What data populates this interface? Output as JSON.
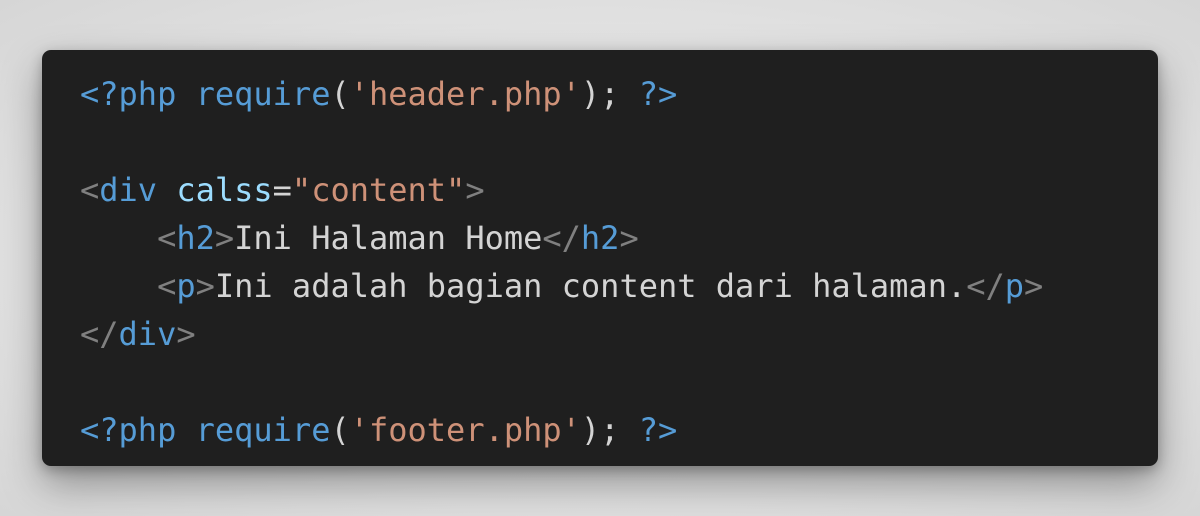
{
  "colors": {
    "background": "#e6e6e6",
    "editor_bg": "#1f1f1f",
    "keyword": "#569cd6",
    "string": "#ce9178",
    "bracket": "#808080",
    "attribute": "#9cdcfe",
    "text": "#d4d4d4"
  },
  "code": {
    "line1": {
      "open": "<?php",
      "fn": "require",
      "lparen": "(",
      "arg": "'header.php'",
      "rparen_semi": ");",
      "close": "?>"
    },
    "line3": {
      "lt": "<",
      "tag": "div",
      "attr": "calss",
      "eq": "=",
      "value": "\"content\"",
      "gt": ">"
    },
    "line4": {
      "indent": "    ",
      "lt1": "<",
      "tag1": "h2",
      "gt1": ">",
      "text": "Ini Halaman Home",
      "lt2": "</",
      "tag2": "h2",
      "gt2": ">"
    },
    "line5": {
      "indent": "    ",
      "lt1": "<",
      "tag1": "p",
      "gt1": ">",
      "text": "Ini adalah bagian content dari halaman.",
      "lt2": "</",
      "tag2": "p",
      "gt2": ">"
    },
    "line6": {
      "lt": "</",
      "tag": "div",
      "gt": ">"
    },
    "line8": {
      "open": "<?php",
      "fn": "require",
      "lparen": "(",
      "arg": "'footer.php'",
      "rparen_semi": ");",
      "close": "?>"
    }
  }
}
